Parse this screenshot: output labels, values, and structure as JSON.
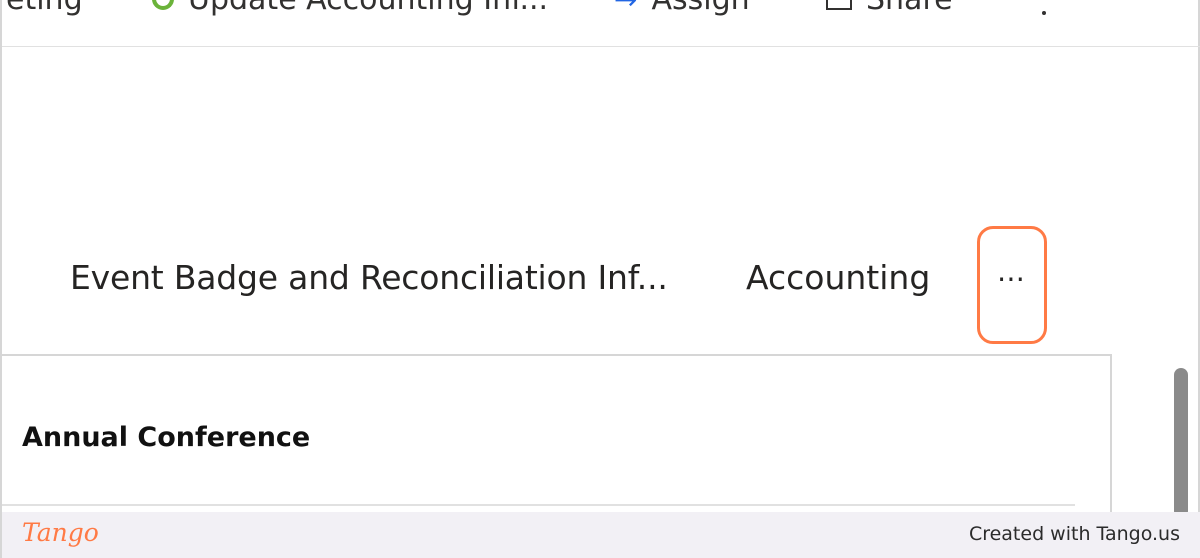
{
  "command_bar": {
    "meeting_label": "eting",
    "update_label": "Update Accounting Inf...",
    "assign_label": "Assign",
    "share_label": "Share"
  },
  "tabs": [
    {
      "label": "Event Badge and Reconciliation Inf..."
    },
    {
      "label": "Accounting"
    }
  ],
  "more_tabs": {
    "glyph": "⋯"
  },
  "panel": {
    "title": "Annual Conference"
  },
  "footer": {
    "logo": "Tango",
    "created_with": "Created with Tango.us"
  },
  "colors": {
    "highlight": "#ff7a45",
    "recycle": "#6bb33a",
    "assign": "#2266e3"
  },
  "icons": [
    "recycle-icon",
    "assign-icon",
    "share-icon",
    "overflow-vertical-icon"
  ]
}
